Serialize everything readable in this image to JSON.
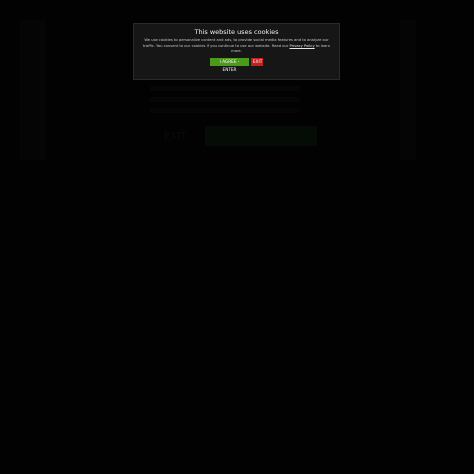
{
  "background": {
    "exit_label": "EXIT"
  },
  "cookie_dialog": {
    "title": "This website uses cookies",
    "text_before_link": "We use cookies to personalize content and ads, to provide social media features and to analyze our traffic. You consent to our cookies if you continue to use our website. Read our ",
    "link_label": "Privacy Policy",
    "text_after_link": " to learn more.",
    "agree_label": "I AGREE - ENTER",
    "exit_label": "EXIT",
    "colors": {
      "agree": "#4c9a1a",
      "exit": "#c0211f",
      "dialog_bg": "#161616"
    }
  }
}
